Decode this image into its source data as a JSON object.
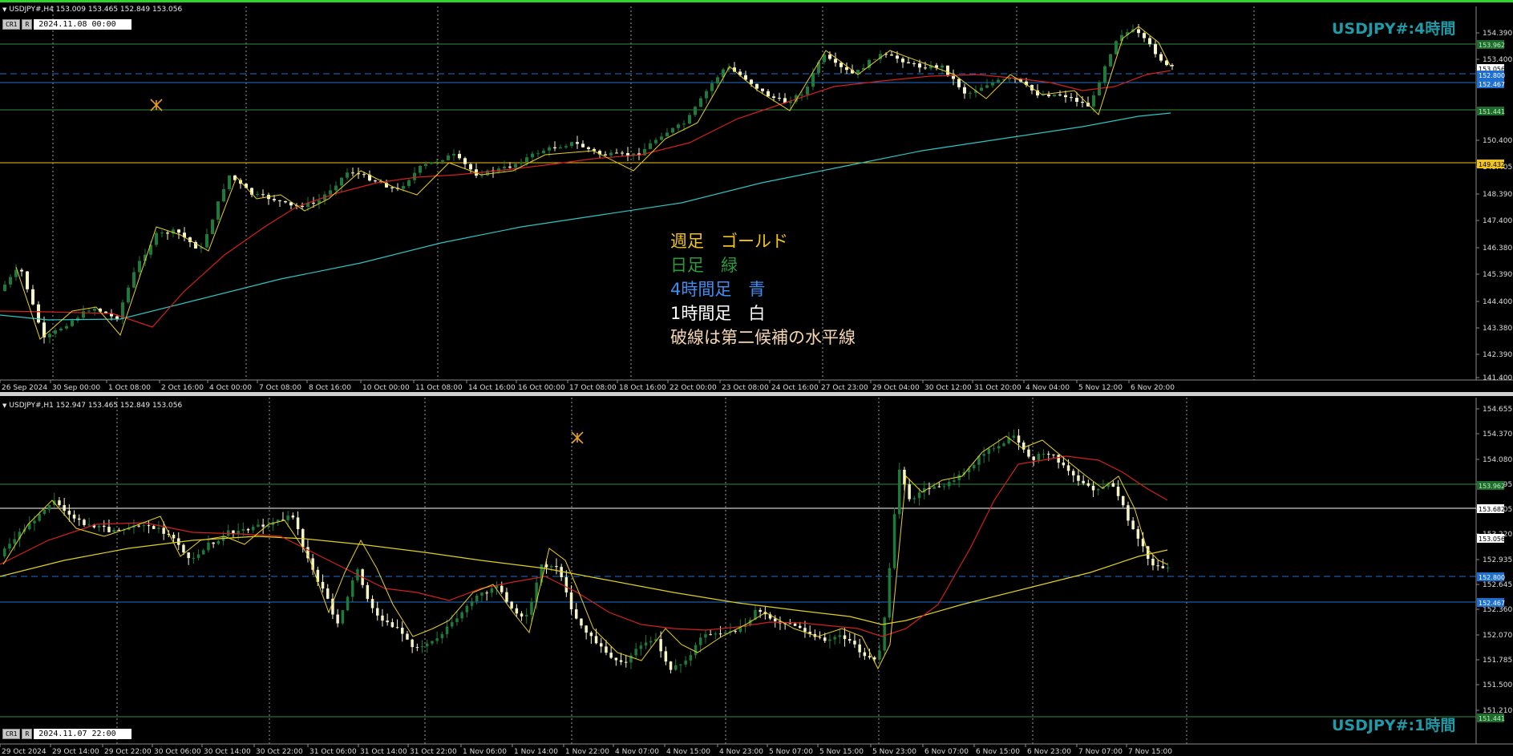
{
  "top_chart": {
    "header": "USDJPY#,H4  153.009 153.465 152.849 153.056",
    "badge_cr": "CR1",
    "badge_r": "R",
    "date_box": "2024.11.08 00:00",
    "symbol_title": "USDJPY#:4時間",
    "price_axis": [
      "154.390",
      "153.400",
      "150.400",
      "149.405",
      "148.390",
      "147.400",
      "146.380",
      "145.390",
      "144.400",
      "143.380",
      "142.390",
      "141.400"
    ],
    "price_tags": [
      {
        "text": "153.962",
        "bg": "#1f6b2e",
        "fg": "#b8f0b8"
      },
      {
        "text": "153.056",
        "bg": "#ffffff",
        "fg": "#000000"
      },
      {
        "text": "152.800",
        "bg": "#1e6fd1",
        "fg": "#ffffff"
      },
      {
        "text": "152.467",
        "bg": "#1e6fd1",
        "fg": "#ffffff"
      },
      {
        "text": "151.441",
        "bg": "#1f6b2e",
        "fg": "#b8f0b8"
      },
      {
        "text": "149.432",
        "bg": "#f0c419",
        "fg": "#000000"
      }
    ],
    "time_axis": [
      "26 Sep 2024",
      "30 Sep 00:00",
      "1 Oct 08:00",
      "2 Oct 16:00",
      "4 Oct 00:00",
      "7 Oct 08:00",
      "8 Oct 16:00",
      "10 Oct 00:00",
      "11 Oct 08:00",
      "14 Oct 16:00",
      "16 Oct 00:00",
      "17 Oct 08:00",
      "18 Oct 16:00",
      "22 Oct 00:00",
      "23 Oct 08:00",
      "24 Oct 16:00",
      "27 Oct 23:00",
      "29 Oct 04:00",
      "30 Oct 12:00",
      "31 Oct 20:00",
      "4 Nov 04:00",
      "5 Nov 12:00",
      "6 Nov 20:00"
    ]
  },
  "legend": {
    "weekly": "週足　ゴールド",
    "daily": "日足　緑",
    "h4": "4時間足　青",
    "h1": "1時間足　白",
    "dashed": "破線は第二候補の水平線"
  },
  "bottom_chart": {
    "header": "USDJPY#,H1  152.947 153.465 152.849 153.056",
    "badge_cr": "CR1",
    "badge_r": "R",
    "date_box": "2024.11.07 22:00",
    "symbol_title": "USDJPY#:1時間",
    "price_axis": [
      "154.655",
      "154.370",
      "154.080",
      "153.795",
      "153.505",
      "153.220",
      "152.935",
      "152.645",
      "152.360",
      "152.070",
      "151.785",
      "151.500",
      "151.210"
    ],
    "price_tags": [
      {
        "text": "153.962",
        "bg": "#1f6b2e",
        "fg": "#b8f0b8"
      },
      {
        "text": "153.682",
        "bg": "#ffffff",
        "fg": "#000000"
      },
      {
        "text": "153.056",
        "bg": "#ffffff",
        "fg": "#000000"
      },
      {
        "text": "152.800",
        "bg": "#1e6fd1",
        "fg": "#ffffff"
      },
      {
        "text": "152.467",
        "bg": "#1e6fd1",
        "fg": "#ffffff"
      },
      {
        "text": "151.441",
        "bg": "#1f6b2e",
        "fg": "#b8f0b8"
      }
    ],
    "time_axis": [
      "29 Oct 2024",
      "29 Oct 14:00",
      "29 Oct 22:00",
      "30 Oct 06:00",
      "30 Oct 14:00",
      "30 Oct 22:00",
      "31 Oct 06:00",
      "31 Oct 14:00",
      "31 Oct 22:00",
      "1 Nov 06:00",
      "1 Nov 14:00",
      "1 Nov 22:00",
      "4 Nov 07:00",
      "4 Nov 15:00",
      "4 Nov 23:00",
      "5 Nov 07:00",
      "5 Nov 15:00",
      "5 Nov 23:00",
      "6 Nov 07:00",
      "6 Nov 15:00",
      "6 Nov 23:00",
      "7 Nov 07:00",
      "7 Nov 15:00"
    ]
  },
  "colors": {
    "weekly_line": "#f0c419",
    "daily_line": "#2e8b3e",
    "h4_line": "#1e6fd1",
    "h1_line": "#ffffff",
    "legend_weekly": "#f0c419",
    "legend_daily": "#2e9a3e",
    "legend_h4": "#3d8ef0",
    "legend_h1": "#ffffff",
    "legend_dashed": "#f5d6b0",
    "bull_candle": "#1d7a3a",
    "bear_candle": "#f5f5c8",
    "ma_fast": "#d42020",
    "ma_slow_top": "#2cc6c6",
    "ma_slow_bottom": "#e0d020",
    "zigzag": "#e8d020"
  },
  "icons": [
    "collapse-triangle-icon",
    "crosshair-tool-icon"
  ]
}
